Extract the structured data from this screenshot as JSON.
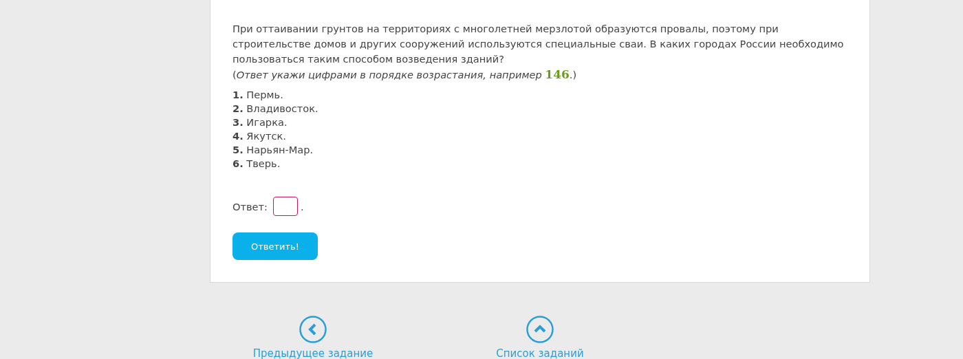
{
  "question": "При оттаивании грунтов на территориях с многолетней мерзлотой образуются провалы, поэтому при строительстве домов и других сооружений используются специальные сваи. В каких городах России необходимо пользоваться таким способом возведения зданий?",
  "hint": {
    "before": "(",
    "italic": "Ответ укажи цифрами в порядке возрастания, например ",
    "example": "146",
    "after": ".)"
  },
  "options": [
    {
      "number": "1.",
      "text": "Пермь."
    },
    {
      "number": "2.",
      "text": "Владивосток."
    },
    {
      "number": "3.",
      "text": "Игарка."
    },
    {
      "number": "4.",
      "text": "Якутск."
    },
    {
      "number": "5.",
      "text": "Нарьян-Мар."
    },
    {
      "number": "6.",
      "text": "Тверь."
    }
  ],
  "answer": {
    "label": "Ответ:",
    "after": "."
  },
  "submit_button": "Ответить!",
  "nav": [
    {
      "kind": "previous",
      "label": "Предыдущее задание"
    },
    {
      "kind": "list",
      "label": "Список заданий"
    }
  ]
}
